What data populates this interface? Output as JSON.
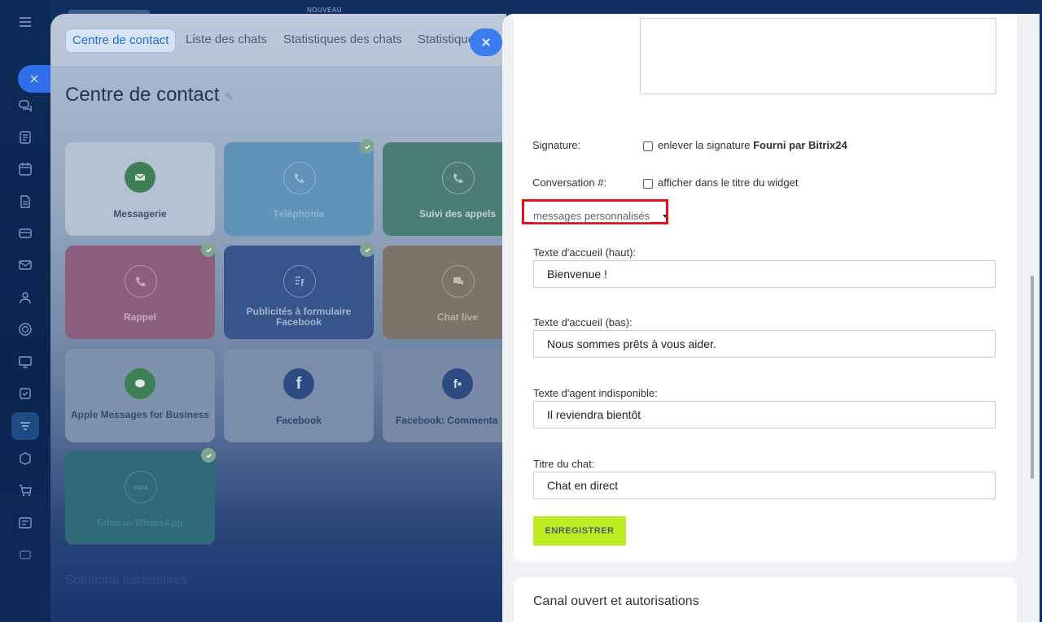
{
  "topbar": {
    "badge": "NOUVEAU"
  },
  "tabs": [
    {
      "label": "Centre de contact"
    },
    {
      "label": "Liste des chats"
    },
    {
      "label": "Statistiques des chats"
    },
    {
      "label": "Statistique"
    }
  ],
  "page": {
    "title": "Centre de contact"
  },
  "tiles": [
    {
      "label": "Messagerie",
      "icon": "envelope-icon"
    },
    {
      "label": "Téléphonie",
      "icon": "phone-icon"
    },
    {
      "label": "Suivi des appels",
      "icon": "call-tracking-icon"
    },
    {
      "label": "Rappel",
      "icon": "callback-icon"
    },
    {
      "label": "Publicités à formulaire Facebook",
      "icon": "facebook-form-icon"
    },
    {
      "label": "Chat live",
      "icon": "chat-icon"
    },
    {
      "label": "Apple Messages for Business",
      "icon": "apple-messages-icon"
    },
    {
      "label": "Facebook",
      "icon": "facebook-icon"
    },
    {
      "label": "Facebook: Commenta",
      "icon": "facebook-comments-icon"
    },
    {
      "label": "Edna.io WhatsApp",
      "icon": "edna-icon"
    }
  ],
  "partners": {
    "label": "Solutions partenaires"
  },
  "form": {
    "signature_label": "Signature:",
    "signature_text": "enlever la signature",
    "signature_bold": "Fourni par Bitrix24",
    "conversation_label": "Conversation #:",
    "conversation_text": "afficher dans le titre du widget",
    "custom_messages": "messages personnalisés",
    "welcome_top_label": "Texte d'accueil (haut):",
    "welcome_top_value": "Bienvenue !",
    "welcome_bottom_label": "Texte d'accueil (bas):",
    "welcome_bottom_value": "Nous sommes prêts à vous aider.",
    "agent_unavailable_label": "Texte d'agent indisponible:",
    "agent_unavailable_value": "Il reviendra bientôt",
    "chat_title_label": "Titre du chat:",
    "chat_title_value": "Chat en direct",
    "save_label": "ENREGISTRER"
  },
  "section2": {
    "title": "Canal ouvert et autorisations"
  },
  "colors": {
    "accent_blue": "#3b7df1",
    "save_green": "#bbed21",
    "highlight_red": "#e3101a"
  }
}
